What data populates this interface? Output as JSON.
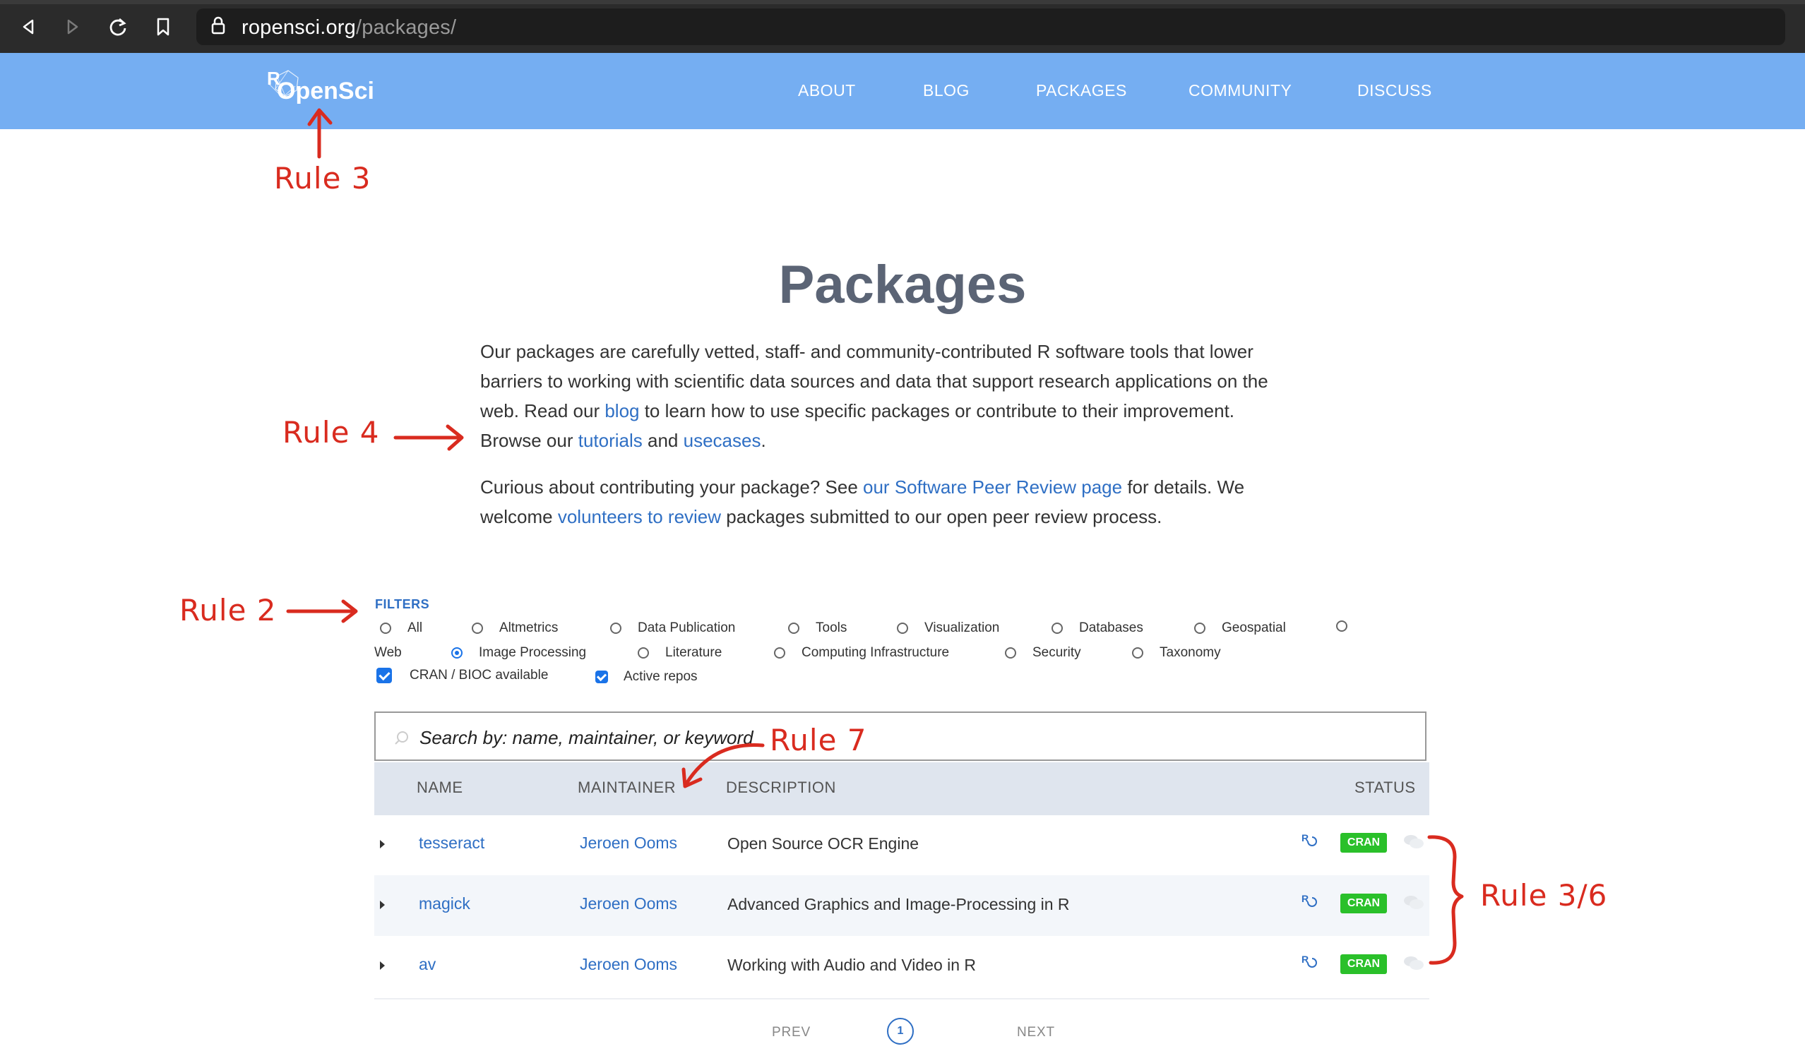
{
  "browser": {
    "url_host": "ropensci.org",
    "url_path": "/packages/"
  },
  "site": {
    "logo_R": "R",
    "logo_text": "OpenSci",
    "nav": [
      "ABOUT",
      "BLOG",
      "PACKAGES",
      "COMMUNITY",
      "DISCUSS"
    ]
  },
  "page": {
    "title": "Packages",
    "intro1": {
      "t1": "Our packages are carefully vetted, staff- and community-contributed R software tools that lower barriers to working with scientific data sources and data that support research applications on the web. Read our ",
      "link_blog": "blog",
      "t2": " to learn how to use specific packages or contribute to their improvement. Browse our ",
      "link_tutorials": "tutorials",
      "t3": " and ",
      "link_usecases": "usecases",
      "t4": "."
    },
    "intro2": {
      "t1": "Curious about contributing your package? See ",
      "link_review": "our Software Peer Review page",
      "t2": " for details. We welcome ",
      "link_volunteers": "volunteers to review",
      "t3": " packages submitted to our open peer review process."
    }
  },
  "filters": {
    "label": "FILTERS",
    "options": [
      "All",
      "Altmetrics",
      "Data Publication",
      "Tools",
      "Visualization",
      "Databases",
      "Geospatial",
      "Web",
      "Image Processing",
      "Literature",
      "Computing Infrastructure",
      "Security",
      "Taxonomy"
    ],
    "selected": "Image Processing",
    "checks": [
      "CRAN / BIOC available",
      "Active repos"
    ]
  },
  "search": {
    "placeholder": "Search by: name, maintainer, or keyword"
  },
  "table": {
    "headers": [
      "NAME",
      "MAINTAINER",
      "DESCRIPTION",
      "STATUS"
    ],
    "rows": [
      {
        "name": "tesseract",
        "maintainer": "Jeroen Ooms",
        "description": "Open Source OCR Engine",
        "badge": "CRAN"
      },
      {
        "name": "magick",
        "maintainer": "Jeroen Ooms",
        "description": "Advanced Graphics and Image-Processing in R",
        "badge": "CRAN"
      },
      {
        "name": "av",
        "maintainer": "Jeroen Ooms",
        "description": "Working with Audio and Video in R",
        "badge": "CRAN"
      }
    ]
  },
  "pagination": {
    "prev": "PREV",
    "current": "1",
    "next": "NEXT"
  },
  "annotations": {
    "rule3_logo": "Rule 3",
    "rule4": "Rule 4",
    "rule2": "Rule 2",
    "rule7": "Rule 7",
    "rule36": "Rule 3/6"
  },
  "colors": {
    "header": "#75aef2",
    "link": "#2f6fc4",
    "cran_badge": "#2ac02a",
    "annotation": "#d92b1f"
  }
}
